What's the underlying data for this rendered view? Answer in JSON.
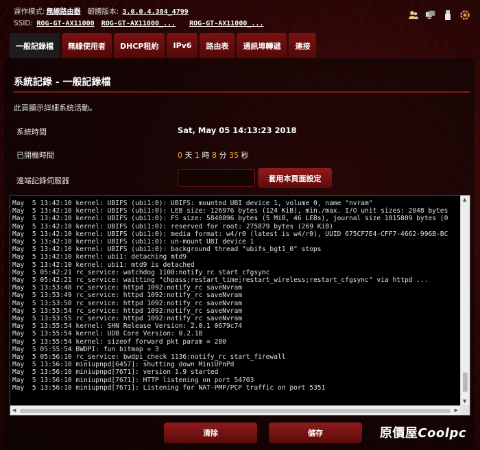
{
  "header": {
    "mode_label": "運作模式:",
    "mode_value": "無線路由器",
    "firmware_label": "韌體版本:",
    "firmware_value": "3.0.0.4.384_4799",
    "ssid_label": "SSID:",
    "ssids": [
      "ROG-GT-AX11000",
      "ROG-GT-AX11000_...",
      "ROG-GT-AX11000_..."
    ],
    "icons": [
      "users-icon",
      "network-clients-icon",
      "usb-icon",
      "settings-gear-icon"
    ]
  },
  "tabs": [
    "一般記錄檔",
    "無線使用者",
    "DHCP租約",
    "IPv6",
    "路由表",
    "通訊埠轉遞",
    "連接"
  ],
  "active_tab": 0,
  "page": {
    "title": "系統記錄 - 一般記錄檔",
    "description": "此頁顯示詳細系統活動。",
    "system_time_label": "系統時間",
    "system_time_value": "Sat, May 05 14:13:23 2018",
    "uptime_label": "已開機時間",
    "uptime": {
      "days": "0",
      "days_unit": "天",
      "hours": "1",
      "hours_unit": "時",
      "minutes": "8",
      "minutes_unit": "分",
      "seconds": "35",
      "seconds_unit": "秒"
    },
    "remote_log_label": "遠端記錄伺服器",
    "remote_log_value": "",
    "apply_button": "套用本頁面設定"
  },
  "log_lines": [
    "May  5 13:42:10 kernel: UBIFS (ubi1:0): UBIFS: mounted UBI device 1, volume 0, name \"nvram\"",
    "May  5 13:42:10 kernel: UBIFS (ubi1:0): LEB size: 126976 bytes (124 KiB), min./max. I/O unit sizes: 2048 bytes",
    "May  5 13:42:10 kernel: UBIFS (ubi1:0): FS size: 5840896 bytes (5 MiB, 46 LEBs), journal size 1015809 bytes (0",
    "May  5 13:42:10 kernel: UBIFS (ubi1:0): reserved for root: 275879 bytes (269 KiB)",
    "May  5 13:42:10 kernel: UBIFS (ubi1:0): media format: w4/r0 (latest is w4/r0), UUID 675CF7E4-CFF7-4662-996B-BC",
    "May  5 13:42:10 kernel: UBIFS (ubi1:0): un-mount UBI device 1",
    "May  5 13:42:10 kernel: UBIFS (ubi1:0): background thread \"ubifs_bgt1_0\" stops",
    "May  5 13:42:10 kernel: ubi1: detaching mtd9",
    "May  5 13:42:10 kernel: ubi1: mtd9 is detached",
    "May  5 05:42:21 rc_service: watchdog 1100:notify_rc start_cfgsync",
    "May  5 05:42:21 rc_service: waitting \"chpass;restart_time;restart_wireless;restart_cfgsync\" via httpd ...",
    "May  5 13:53:48 rc_service: httpd 1092:notify_rc saveNvram",
    "May  5 13:53:49 rc_service: httpd 1092:notify_rc saveNvram",
    "May  5 13:53:50 rc_service: httpd 1092:notify_rc saveNvram",
    "May  5 13:53:54 rc_service: httpd 1092:notify_rc saveNvram",
    "May  5 13:53:55 rc_service: httpd 1092:notify_rc saveNvram",
    "May  5 13:55:54 kernel: SHN Release Version: 2.0.1 0679c74",
    "May  5 13:55:54 kernel: UDB Core Version: 0.2.18",
    "May  5 13:55:54 kernel: sizeof forward pkt param = 280",
    "May  5 05:55:54 BWDPI: fun bitmap = 3",
    "May  5 05:56:10 rc_service: bwdpi_check 1136:notify_rc start_firewall",
    "May  5 13:56:10 miniupnpd[6457]: shutting down MiniUPnPd",
    "May  5 13:56:10 miniupnpd[7671]: version 1.9 started",
    "May  5 13:56:10 miniupnpd[7671]: HTTP listening on port 54703",
    "May  5 13:56:10 miniupnpd[7671]: Listening for NAT-PMP/PCP traffic on port 5351"
  ],
  "log_text": "",
  "buttons": {
    "clear": "清除",
    "save": "儲存"
  },
  "watermark": {
    "zh": "原價屋",
    "en": "Coolpc"
  },
  "colors": {
    "accent": "#8f1b1b",
    "uptime_number": "#ffb326",
    "divider": "#8a1414"
  }
}
